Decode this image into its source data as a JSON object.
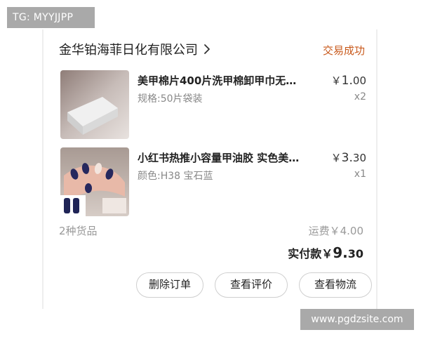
{
  "watermarks": {
    "top_left": "TG: MYYJJPP",
    "bottom_right": "www.pgdzsite.com"
  },
  "order": {
    "shop_name": "金华铂海菲日化有限公司",
    "status": "交易成功",
    "status_color": "#c8581a",
    "items": [
      {
        "title": "美甲棉片400片洗甲棉卸甲巾无…",
        "spec": "规格:50片袋装",
        "price_symbol": "￥",
        "price_int": "1.",
        "price_dec": "00",
        "qty": "x2",
        "thumb_icon": "cotton-pad-product-image"
      },
      {
        "title": "小红书热推小容量甲油胶 实色美…",
        "spec": "颜色:H38 宝石蓝",
        "price_symbol": "￥",
        "price_int": "3.",
        "price_dec": "30",
        "qty": "x1",
        "thumb_icon": "nail-polish-product-image"
      }
    ],
    "item_count": "2种货品",
    "shipping": "运费￥4.00",
    "paid_label": "实付款",
    "paid_symbol": "￥",
    "paid_int": "9.",
    "paid_dec": "30",
    "buttons": {
      "delete": "删除订单",
      "review": "查看评价",
      "logistics": "查看物流"
    }
  }
}
